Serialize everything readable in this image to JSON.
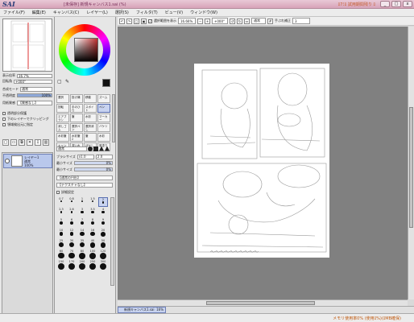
{
  "titlebar": {
    "logo": "SAI",
    "title": "[未保存] 新規キャンバス1.sai (%)",
    "trial": "ﾛ7ﾐﾛ 試用期間残り ﾛ",
    "min": "_",
    "max": "□",
    "close": "x"
  },
  "menu": {
    "items": [
      "ファイル(F)",
      "編集(E)",
      "キャンバス(C)",
      "レイヤー(L)",
      "選択(S)",
      "フィルタ(T)",
      "ビュー(V)",
      "ウィンドウ(W)"
    ]
  },
  "toolbar": {
    "show_selection_label": "選択範囲を表示",
    "zoom": "16.66%",
    "angle": "+000°",
    "mode": "通常",
    "stabilizer_label": "手ぶれ補正",
    "stabilizer_value": "3"
  },
  "navigator": {
    "zoom_label": "表示倍率",
    "zoom_value": "16.7%",
    "angle_label": "回転角",
    "angle_value": "+000°"
  },
  "layer_props": {
    "blend_label": "合成モード",
    "blend_value": "通常",
    "opacity_label": "不透明度",
    "opacity_value": "100%",
    "group_label": "用紙質感",
    "group_value": "【質感なし】",
    "options": [
      "透明部分保護",
      "下のレイヤーでクリッピング",
      "領域検出元に指定"
    ]
  },
  "layers": {
    "items": [
      {
        "name": "レイヤー1",
        "mode": "通常",
        "opacity": "100%"
      }
    ]
  },
  "tools": {
    "items": [
      "選択",
      "投げ縄",
      "移動",
      "ズーム",
      "回転",
      "手のひら",
      "スポイト",
      "ペン",
      "エアブラシ",
      "筆",
      "水彩",
      "マーカー",
      "消しゴム",
      "選択ペン",
      "選択消し",
      "バケツ",
      "水彩筆",
      "水彩筆2",
      "筆",
      "水彩",
      "キャンバス",
      "濃い水彩",
      "ぼかし",
      "厚塗り"
    ],
    "active_index": 7
  },
  "brush_props": {
    "blend_value": "通常",
    "size_label": "ブラシサイズ",
    "size_mult": "x1.0",
    "size_value": "2.0",
    "density_label": "最小サイズ",
    "density_value": "0%",
    "min_label": "最小サイズ",
    "min_value": "0%",
    "shape_label": "【通常の円形】",
    "texture_label": "【テクスチャなし】",
    "detail_label": "詳細設定"
  },
  "brush_sizes": {
    "labels": [
      "0.7",
      "0.8",
      "1",
      "1.5",
      "2",
      "2.3",
      "2.6",
      "3",
      "3.5",
      "4",
      "5",
      "6",
      "7",
      "8",
      "9",
      "10",
      "12",
      "14",
      "16",
      "20",
      "25",
      "30",
      "35",
      "40",
      "50",
      "60",
      "70",
      "80",
      "100",
      "120",
      "150",
      "170",
      "200",
      "250",
      "300"
    ],
    "selected_index": 4
  },
  "document": {
    "tab_label": "新規キャンバス1.sai",
    "tab_zoom": "16%"
  },
  "status": {
    "text": "メモリ使用率0% (使用ﾛ%)(ﾛMB確保)"
  },
  "colors": {
    "titlebar": "#d7a3b8",
    "canvas_bg": "#808080",
    "selection": "#c8d3f0"
  }
}
